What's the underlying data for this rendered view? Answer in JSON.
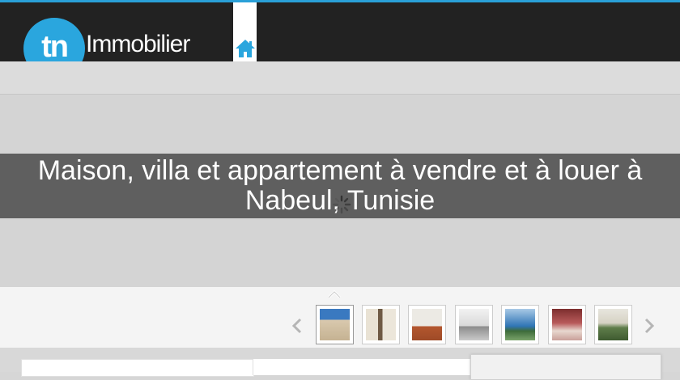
{
  "header": {
    "logo_text": "tn",
    "brand_name": "Immobilier",
    "home_icon": "home-icon"
  },
  "hero": {
    "caption": "Maison, villa et appartement à vendre et à louer à Nabeul, Tunisie",
    "loading_icon": "spinner-icon"
  },
  "carousel": {
    "prev_icon": "chevron-left-icon",
    "next_icon": "chevron-right-icon",
    "collapse_icon": "chevron-up-icon"
  },
  "colors": {
    "accent": "#2aa6de",
    "topbar": "#222222",
    "caption_band": "#5f5f5f"
  }
}
